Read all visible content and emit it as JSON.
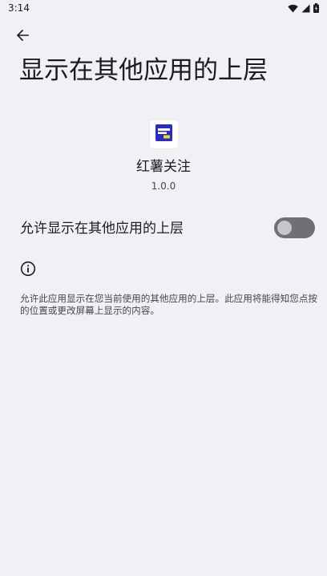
{
  "status_bar": {
    "time": "3:14",
    "icons": [
      "wifi-icon",
      "cellular-signal-icon",
      "battery-icon"
    ]
  },
  "navigation": {
    "back_icon": "arrow-back-icon"
  },
  "page": {
    "title": "显示在其他应用的上层"
  },
  "app": {
    "icon": "app-logo-icon",
    "name": "红薯关注",
    "version": "1.0.0"
  },
  "setting": {
    "label": "允许显示在其他应用的上层",
    "enabled": false
  },
  "info": {
    "icon": "info-icon",
    "description": "允许此应用显示在您当前使用的其他应用的上层。此应用将能得知您点按的位置或更改屏幕上显示的内容。"
  },
  "colors": {
    "background": "#eff1f5",
    "toggle_track_off": "#6f7075",
    "toggle_thumb_off": "#c5c6cb",
    "app_logo_blue": "#2b2fb8",
    "app_logo_yellow": "#f2d23a"
  }
}
